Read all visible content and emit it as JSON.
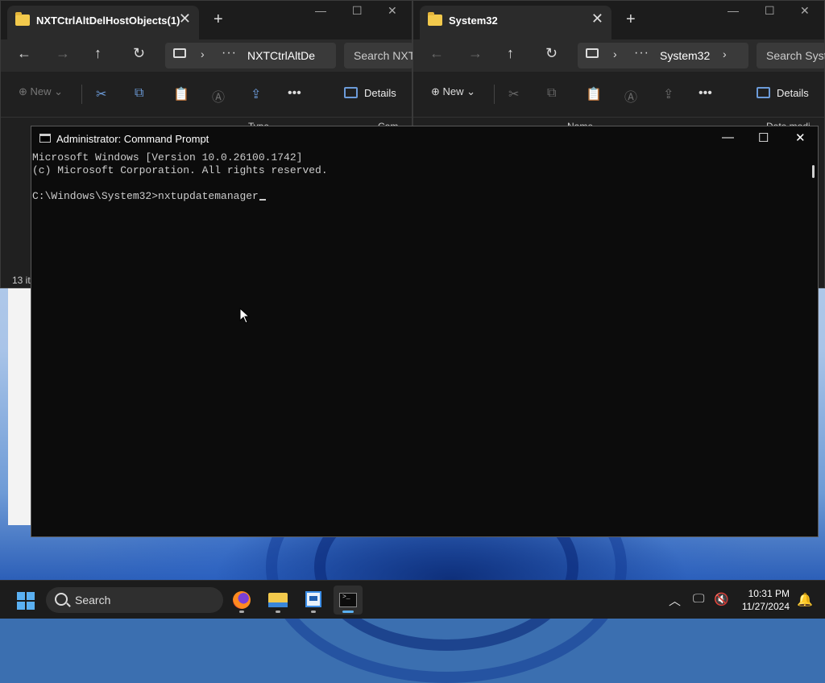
{
  "explorer_left": {
    "tab_title": "NXTCtrlAltDelHostObjects(1)",
    "breadcrumb": "NXTCtrlAltDe",
    "search_placeholder": "Search NXTC",
    "new_label": "New",
    "details_label": "Details",
    "col_type": "Type",
    "col_com": "Com",
    "status": "13 it"
  },
  "explorer_right": {
    "tab_title": "System32",
    "breadcrumb": "System32",
    "search_placeholder": "Search Syste",
    "new_label": "New",
    "details_label": "Details",
    "col_name": "Name",
    "col_date": "Date modi"
  },
  "cmd": {
    "title": "Administrator: Command Prompt",
    "lines": [
      "Microsoft Windows [Version 10.0.26100.1742]",
      "(c) Microsoft Corporation. All rights reserved.",
      "",
      "C:\\Windows\\System32>nxtupdatemanager"
    ]
  },
  "taskbar": {
    "search_label": "Search",
    "time": "10:31 PM",
    "date": "11/27/2024",
    "apps": [
      "firefox-icon",
      "file-explorer-icon",
      "notepad-icon",
      "terminal-icon"
    ]
  },
  "colors": {
    "accent": "#5ab0f2",
    "console_bg": "#0c0c0c",
    "console_fg": "#cccccc",
    "folder": "#f2c94c"
  }
}
